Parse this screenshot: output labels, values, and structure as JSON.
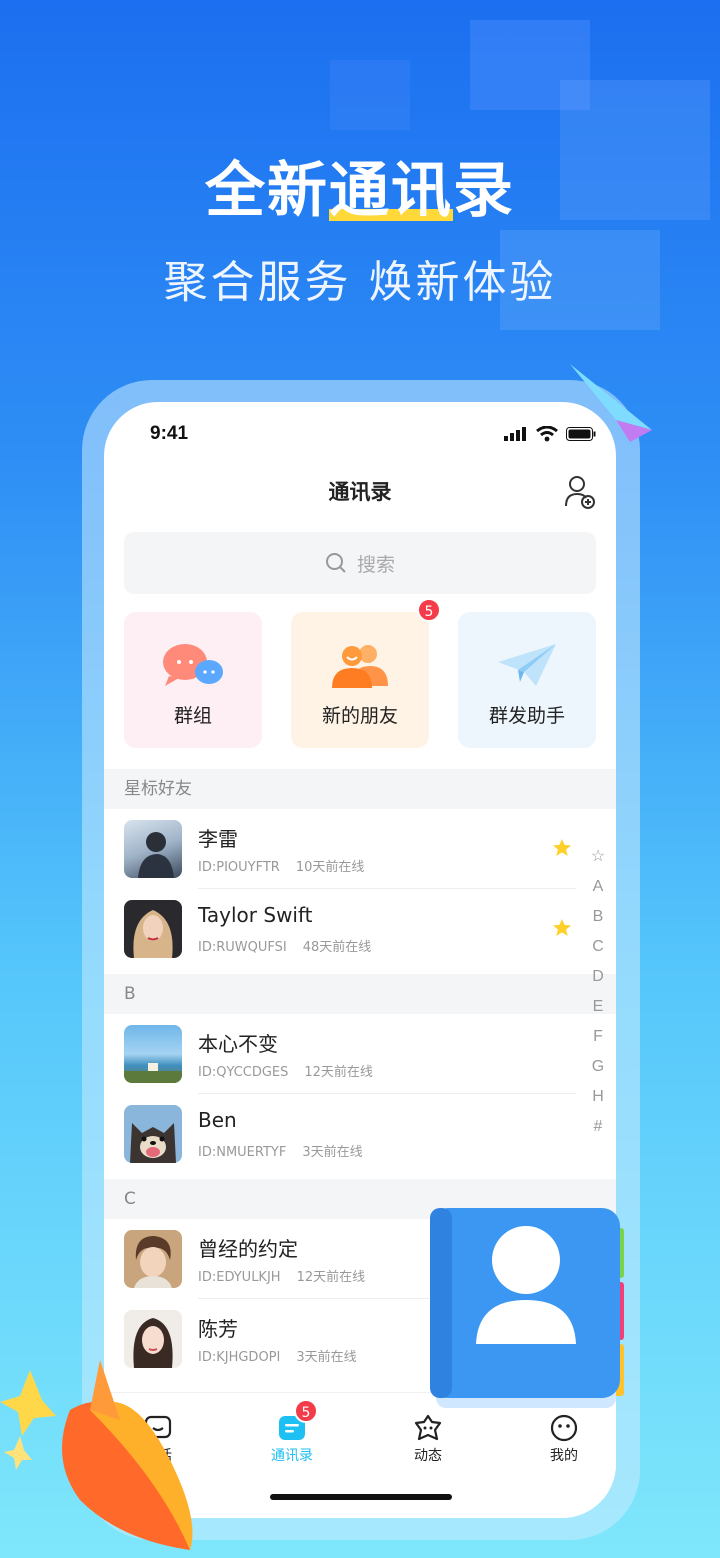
{
  "hero": {
    "title_pre": "全新",
    "title_hl": "通讯",
    "title_post": "录",
    "subtitle": "聚合服务 焕新体验"
  },
  "status": {
    "time": "9:41"
  },
  "header": {
    "title": "通讯录"
  },
  "search": {
    "placeholder": "搜索"
  },
  "cards": [
    {
      "label": "群组",
      "bg": "#fdeff3"
    },
    {
      "label": "新的朋友",
      "bg": "#fff3e6",
      "badge": "5"
    },
    {
      "label": "群发助手",
      "bg": "#eef6fd"
    }
  ],
  "sections": [
    {
      "title": "星标好友"
    },
    {
      "title": "B"
    },
    {
      "title": "C"
    }
  ],
  "contacts": [
    {
      "name": "李雷",
      "id": "ID:PIOUYFTR",
      "online": "10天前在线",
      "starred": true
    },
    {
      "name": "Taylor Swift",
      "id": "ID:RUWQUFSI",
      "online": "48天前在线",
      "starred": true
    },
    {
      "name": "本心不变",
      "id": "ID:QYCCDGES",
      "online": "12天前在线"
    },
    {
      "name": "Ben",
      "id": "ID:NMUERTYF",
      "online": "3天前在线"
    },
    {
      "name": "曾经的约定",
      "id": "ID:EDYULKJH",
      "online": "12天前在线"
    },
    {
      "name": "陈芳",
      "id": "ID:KJHGDOPI",
      "online": "3天前在线"
    }
  ],
  "index": [
    "☆",
    "A",
    "B",
    "C",
    "D",
    "E",
    "F",
    "G",
    "H",
    "#"
  ],
  "tabs": [
    {
      "label": "对话"
    },
    {
      "label": "通讯录",
      "badge": "5"
    },
    {
      "label": "动态"
    },
    {
      "label": "我的"
    }
  ],
  "colors": {
    "accent": "#1ec0f3",
    "badge": "#f43b4a",
    "star": "#ffd02a"
  }
}
